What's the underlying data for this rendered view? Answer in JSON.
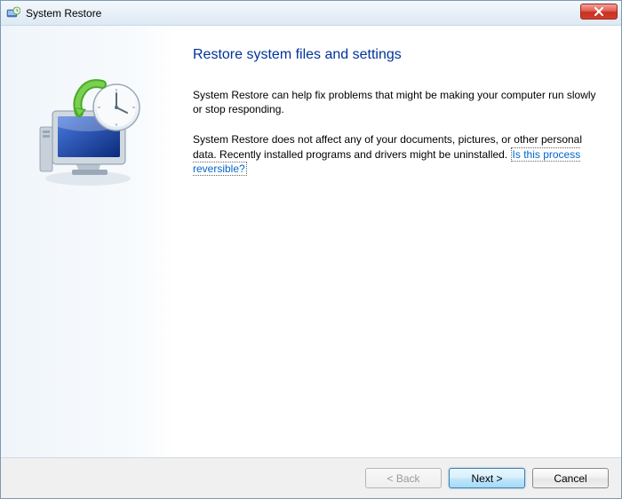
{
  "titlebar": {
    "title": "System Restore"
  },
  "main": {
    "heading": "Restore system files and settings",
    "para1": "System Restore can help fix problems that might be making your computer run slowly or stop responding.",
    "para2_prefix": "System Restore does not affect any of your documents, pictures, or other personal data. Recently installed programs and drivers might be uninstalled. ",
    "link_text": "Is this process reversible?"
  },
  "footer": {
    "back": "< Back",
    "next": "Next >",
    "cancel": "Cancel"
  }
}
